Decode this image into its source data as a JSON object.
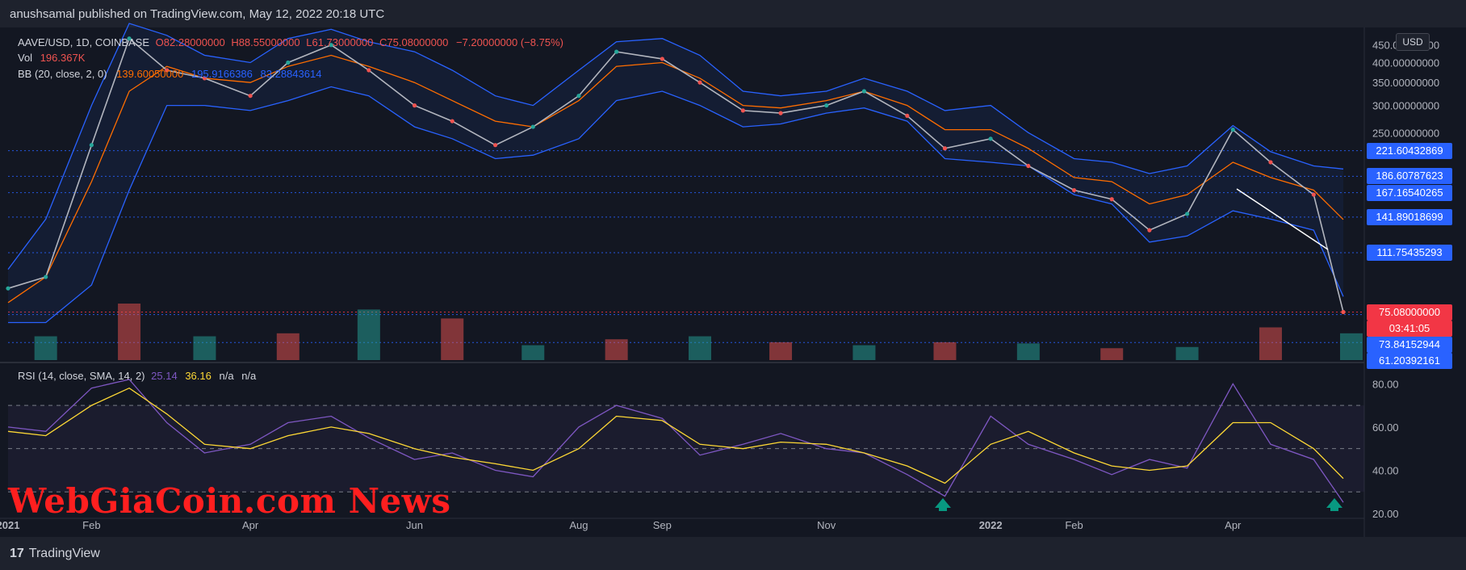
{
  "header": {
    "published": "anushsamal published on TradingView.com, May 12, 2022 20:18 UTC"
  },
  "footer": {
    "brand": "TradingView",
    "watermark": "WebGiaCoin.com News"
  },
  "currency_button": "USD",
  "legend": {
    "symbol": "AAVE/USD, 1D, COINBASE",
    "open": "O82.28000000",
    "high": "H88.55000000",
    "low": "L61.73000000",
    "close": "C75.08000000",
    "change": "−7.20000000 (−8.75%)",
    "vol_label": "Vol",
    "vol_value": "196.367K",
    "bb_label": "BB (20, close, 2, 0)",
    "bb_basis": "139.60050000",
    "bb_upper": "195.9166386",
    "bb_lower": "83.28843614",
    "rsi_label": "RSI (14, close, SMA, 14, 2)",
    "rsi_value": "25.14",
    "rsi_sma": "36.16",
    "rsi_na1": "n/a",
    "rsi_na2": "n/a"
  },
  "colors": {
    "up": "#26a69a",
    "down": "#ef5350",
    "bb_band": "#2962ff",
    "bb_basis": "#ff6d00",
    "rsi_line": "#7e57c2",
    "rsi_sma": "#fdd835",
    "badge_blue": "#2962ff",
    "badge_red": "#f23645"
  },
  "price_axis": [
    "450.00000000",
    "400.00000000",
    "350.00000000",
    "300.00000000",
    "250.00000000"
  ],
  "rsi_axis": [
    "80.00",
    "60.00",
    "40.00",
    "20.00"
  ],
  "time_axis": [
    "2021",
    "Feb",
    "Apr",
    "Jun",
    "Aug",
    "Sep",
    "Nov",
    "2022",
    "Feb",
    "Apr"
  ],
  "price_levels": [
    {
      "label": "221.60432869",
      "value": 221.60432869,
      "color": "#2962ff"
    },
    {
      "label": "186.60787623",
      "value": 186.60787623,
      "color": "#2962ff"
    },
    {
      "label": "167.16540265",
      "value": 167.16540265,
      "color": "#2962ff"
    },
    {
      "label": "141.89018699",
      "value": 141.89018699,
      "color": "#2962ff"
    },
    {
      "label": "111.75435293",
      "value": 111.75435293,
      "color": "#2962ff"
    },
    {
      "label": "75.08000000",
      "value": 75.08,
      "color": "#f23645",
      "countdown": "03:41:05"
    },
    {
      "label": "73.84152944",
      "value": 73.84152944,
      "color": "#2962ff"
    },
    {
      "label": "61.20392161",
      "value": 61.20392161,
      "color": "#2962ff"
    }
  ],
  "chart_data": [
    {
      "type": "line",
      "title": "AAVE/USD, 1D, COINBASE",
      "x": [
        "2021-01-01",
        "2021-01-15",
        "2021-02-01",
        "2021-02-15",
        "2021-03-01",
        "2021-03-15",
        "2021-04-01",
        "2021-04-15",
        "2021-05-01",
        "2021-05-15",
        "2021-06-01",
        "2021-06-15",
        "2021-07-01",
        "2021-07-15",
        "2021-08-01",
        "2021-08-15",
        "2021-09-01",
        "2021-09-15",
        "2021-10-01",
        "2021-10-15",
        "2021-11-01",
        "2021-11-15",
        "2021-12-01",
        "2021-12-15",
        "2022-01-01",
        "2022-01-15",
        "2022-02-01",
        "2022-02-15",
        "2022-03-01",
        "2022-03-15",
        "2022-04-01",
        "2022-04-15",
        "2022-05-01",
        "2022-05-12"
      ],
      "series": [
        {
          "name": "AAVE/USD",
          "values": [
            88,
            95,
            230,
            470,
            380,
            360,
            320,
            400,
            450,
            380,
            300,
            270,
            230,
            260,
            320,
            430,
            410,
            350,
            290,
            285,
            300,
            330,
            280,
            225,
            240,
            200,
            170,
            160,
            130,
            145,
            255,
            205,
            165,
            75.08
          ]
        },
        {
          "name": "BB upper",
          "values": [
            100,
            140,
            300,
            520,
            480,
            420,
            400,
            470,
            500,
            460,
            430,
            380,
            320,
            300,
            380,
            460,
            470,
            420,
            330,
            320,
            330,
            360,
            330,
            290,
            300,
            250,
            210,
            205,
            190,
            200,
            262,
            220,
            200,
            195.92
          ]
        },
        {
          "name": "BB basis",
          "values": [
            80,
            95,
            180,
            330,
            390,
            360,
            350,
            390,
            420,
            390,
            350,
            310,
            270,
            260,
            310,
            390,
            400,
            360,
            300,
            295,
            310,
            330,
            300,
            255,
            255,
            225,
            185,
            180,
            155,
            165,
            205,
            185,
            170,
            139.6
          ]
        },
        {
          "name": "BB lower",
          "values": [
            70,
            70,
            90,
            170,
            300,
            300,
            290,
            310,
            340,
            320,
            260,
            240,
            210,
            215,
            240,
            310,
            330,
            300,
            260,
            265,
            285,
            295,
            270,
            210,
            205,
            200,
            165,
            155,
            120,
            125,
            148,
            140,
            130,
            83.29
          ]
        }
      ],
      "ylim": [
        55,
        490
      ],
      "grid": true,
      "legend": "top-left"
    },
    {
      "type": "bar",
      "title": "Vol",
      "categories": [
        "2021-01",
        "2021-02",
        "2021-03",
        "2021-04",
        "2021-05",
        "2021-06",
        "2021-07",
        "2021-08",
        "2021-09",
        "2021-10",
        "2021-11",
        "2021-12",
        "2022-01",
        "2022-02",
        "2022-03",
        "2022-04",
        "2022-05"
      ],
      "values": [
        40,
        95,
        40,
        45,
        85,
        70,
        25,
        35,
        40,
        30,
        25,
        30,
        28,
        20,
        22,
        55,
        45
      ]
    },
    {
      "type": "line",
      "title": "RSI (14, close, SMA, 14, 2)",
      "x": [
        "2021-01-01",
        "2021-01-15",
        "2021-02-01",
        "2021-02-15",
        "2021-03-01",
        "2021-03-15",
        "2021-04-01",
        "2021-04-15",
        "2021-05-01",
        "2021-05-15",
        "2021-06-01",
        "2021-06-15",
        "2021-07-01",
        "2021-07-15",
        "2021-08-01",
        "2021-08-15",
        "2021-09-01",
        "2021-09-15",
        "2021-10-01",
        "2021-10-15",
        "2021-11-01",
        "2021-11-15",
        "2021-12-01",
        "2021-12-15",
        "2022-01-01",
        "2022-01-15",
        "2022-02-01",
        "2022-02-15",
        "2022-03-01",
        "2022-03-15",
        "2022-04-01",
        "2022-04-15",
        "2022-05-01",
        "2022-05-12"
      ],
      "series": [
        {
          "name": "RSI",
          "values": [
            60,
            58,
            78,
            82,
            62,
            48,
            52,
            62,
            65,
            55,
            45,
            48,
            40,
            37,
            60,
            70,
            64,
            47,
            52,
            57,
            50,
            48,
            38,
            28,
            65,
            52,
            45,
            38,
            45,
            41,
            80,
            52,
            45,
            25.14
          ]
        },
        {
          "name": "SMA",
          "values": [
            58,
            56,
            70,
            78,
            66,
            52,
            50,
            56,
            60,
            57,
            50,
            46,
            43,
            40,
            50,
            65,
            63,
            52,
            50,
            53,
            52,
            48,
            42,
            34,
            52,
            58,
            48,
            42,
            40,
            42,
            62,
            62,
            50,
            36.16
          ]
        }
      ],
      "ylim": [
        20,
        82
      ],
      "grid": true
    }
  ]
}
